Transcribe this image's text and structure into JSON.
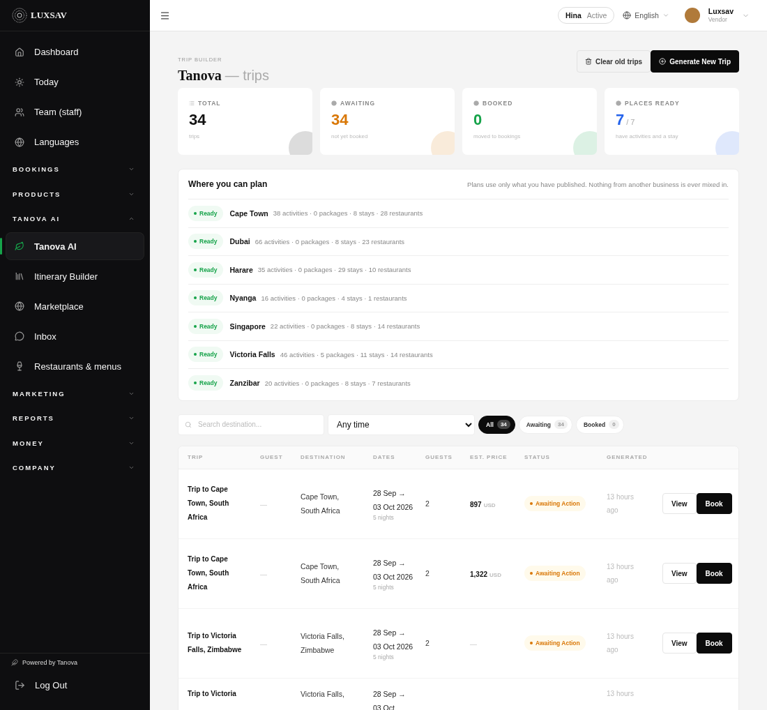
{
  "brand": {
    "name": "LUXSAV"
  },
  "sidebar": {
    "items": [
      {
        "kind": "link",
        "label": "Dashboard",
        "selected": false
      },
      {
        "kind": "link",
        "label": "Today",
        "selected": false
      },
      {
        "kind": "link",
        "label": "Team (staff)",
        "selected": false
      },
      {
        "kind": "link",
        "label": "Languages",
        "selected": false
      },
      {
        "kind": "section",
        "label": "BOOKINGS",
        "expanded": false
      },
      {
        "kind": "section",
        "label": "PRODUCTS",
        "expanded": false
      },
      {
        "kind": "section",
        "label": "TANOVA AI",
        "expanded": true,
        "children": [
          {
            "kind": "link",
            "label": "Tanova AI",
            "selected": true
          },
          {
            "kind": "link",
            "label": "Itinerary Builder",
            "selected": false
          },
          {
            "kind": "link",
            "label": "Marketplace",
            "selected": false
          },
          {
            "kind": "link",
            "label": "Inbox",
            "selected": false
          },
          {
            "kind": "link",
            "label": "Restaurants & menus",
            "selected": false
          }
        ]
      },
      {
        "kind": "section",
        "label": "MARKETING",
        "expanded": false
      },
      {
        "kind": "section",
        "label": "REPORTS",
        "expanded": false
      },
      {
        "kind": "section",
        "label": "MONEY",
        "expanded": false
      },
      {
        "kind": "section",
        "label": "COMPANY",
        "expanded": false
      }
    ],
    "powered_by": "Powered by Tanova",
    "logout": "Log Out"
  },
  "topbar": {
    "user": "Hina",
    "user_status": "Active",
    "language": "English",
    "account": {
      "name": "Luxsav",
      "role": "Vendor"
    }
  },
  "page": {
    "eyebrow": "TRIP BUILDER",
    "title": "Tanova",
    "subtitle": "— trips",
    "buttons": [
      {
        "kind": "secondary",
        "label": "Clear old trips"
      },
      {
        "kind": "primary",
        "label": "Generate New Trip"
      }
    ]
  },
  "stats": [
    {
      "label": "TOTAL",
      "value": "34",
      "caption": "trips",
      "color": "#111111"
    },
    {
      "label": "AWAITING",
      "value": "34",
      "caption": "not yet booked",
      "color": "#d97706"
    },
    {
      "label": "BOOKED",
      "value": "0",
      "caption": "moved to bookings",
      "color": "#16a34a"
    },
    {
      "label": "PLACES READY",
      "value": "7",
      "suffix": "/ 7",
      "caption": "have activities and a stay",
      "color": "#2563eb"
    }
  ],
  "places": {
    "title": "Where you can plan",
    "note": "Plans use only what you have published. Nothing from another business is ever mixed in.",
    "rows": [
      {
        "status": "Ready",
        "name": "Cape Town",
        "details": "38 activities · 0 packages · 8 stays · 28 restaurants"
      },
      {
        "status": "Ready",
        "name": "Dubai",
        "details": "66 activities · 0 packages · 8 stays · 23 restaurants"
      },
      {
        "status": "Ready",
        "name": "Harare",
        "details": "35 activities · 0 packages · 29 stays · 10 restaurants"
      },
      {
        "status": "Ready",
        "name": "Nyanga",
        "details": "16 activities · 0 packages · 4 stays · 1 restaurants"
      },
      {
        "status": "Ready",
        "name": "Singapore",
        "details": "22 activities · 0 packages · 8 stays · 14 restaurants"
      },
      {
        "status": "Ready",
        "name": "Victoria Falls",
        "details": "46 activities · 5 packages · 11 stays · 14 restaurants"
      },
      {
        "status": "Ready",
        "name": "Zanzibar",
        "details": "20 activities · 0 packages · 8 stays · 7 restaurants"
      }
    ]
  },
  "filters": {
    "search": {
      "placeholder": "Search destination..."
    },
    "time": "Any time",
    "pills": [
      {
        "label": "All",
        "count": "34",
        "selected": true
      },
      {
        "label": "Awaiting",
        "count": "34",
        "selected": false
      },
      {
        "label": "Booked",
        "count": "0",
        "selected": false
      }
    ]
  },
  "table": {
    "columns": [
      "TRIP",
      "GUEST",
      "DESTINATION",
      "DATES",
      "GUESTS",
      "EST. PRICE",
      "STATUS",
      "GENERATED"
    ],
    "rows": [
      {
        "trip": "Trip to Cape Town, South Africa",
        "guest": "—",
        "destination": "Cape Town, South Africa",
        "dates": "28 Sep → 03 Oct 2026",
        "nights": "5 nights",
        "guests": "2",
        "price": "897",
        "currency": "USD",
        "status": "Awaiting Action",
        "generated": "13 hours ago",
        "actions": [
          "View",
          "Book"
        ]
      },
      {
        "trip": "Trip to Cape Town, South Africa",
        "guest": "—",
        "destination": "Cape Town, South Africa",
        "dates": "28 Sep → 03 Oct 2026",
        "nights": "5 nights",
        "guests": "2",
        "price": "1,322",
        "currency": "USD",
        "status": "Awaiting Action",
        "generated": "13 hours ago",
        "actions": [
          "View",
          "Book"
        ]
      },
      {
        "trip": "Trip to Victoria Falls, Zimbabwe",
        "guest": "—",
        "destination": "Victoria Falls, Zimbabwe",
        "dates": "28 Sep → 03 Oct 2026",
        "nights": "5 nights",
        "guests": "2",
        "price": "—",
        "status": "Awaiting Action",
        "generated": "13 hours ago",
        "actions": [
          "View",
          "Book"
        ]
      },
      {
        "trip": "Trip to Victoria",
        "destination": "Victoria Falls,",
        "dates": "28 Sep → 03 Oct",
        "generated": "13 hours"
      }
    ]
  }
}
